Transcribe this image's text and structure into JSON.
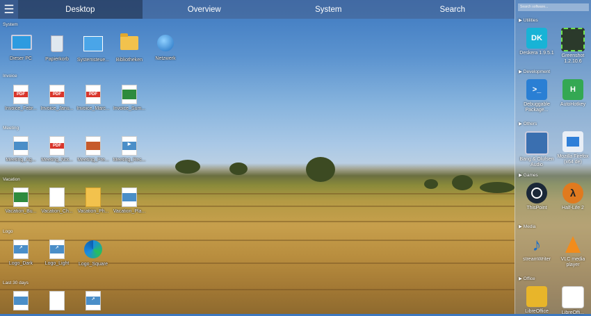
{
  "topbar": {
    "menu_icon": "hamburger-icon",
    "tabs": [
      {
        "label": "Desktop",
        "active": true
      },
      {
        "label": "Overview",
        "active": false
      },
      {
        "label": "System",
        "active": false
      },
      {
        "label": "Search",
        "active": false
      }
    ]
  },
  "sections": {
    "system": {
      "label": "System",
      "items": [
        "Dieser PC",
        "Papierkorb",
        "Systemsteue...",
        "Bibliotheken",
        "Netzwerk"
      ]
    },
    "invoice": {
      "label": "Invoice",
      "items": [
        "Invoice_Febr...",
        "Invoice_Janu...",
        "Invoice_Marc...",
        "Invoice_Sum..."
      ]
    },
    "meeting": {
      "label": "Meeting",
      "items": [
        "Meeting_Ag...",
        "Meeting_Not...",
        "Meeting_Pre...",
        "Meeting_Rec..."
      ]
    },
    "vacation": {
      "label": "Vacation",
      "items": [
        "Vacation_Bu...",
        "Vacation_Ch...",
        "Vacation_Ph...",
        "Vacation_Pla..."
      ]
    },
    "logo": {
      "label": "Logo",
      "items": [
        "Logo_Dark",
        "Logo_Light",
        "Logo_Square"
      ]
    },
    "last30": {
      "label": "Last 30 days",
      "items": [
        "",
        "",
        ""
      ]
    }
  },
  "panel": {
    "search_placeholder": "Search software...",
    "categories": {
      "utilities": "▶ Utilities",
      "development": "▶ Development",
      "others": "▶ Others",
      "games": "▶ Games",
      "media": "▶ Media",
      "office": "▶ Office"
    },
    "apps": {
      "deskera": {
        "name": "Deskera 1.9.5.1",
        "tile_text": "DK",
        "color": "#18b3d6"
      },
      "greenshot": {
        "name": "Greenshot 1.2.10.6",
        "tile_text": "",
        "color": "#2b3a2b"
      },
      "debuggable": {
        "name": "Debuggable Package...",
        "tile_text": ">_",
        "color": "#2a7fd4"
      },
      "autohotkey": {
        "name": "AutoHotkey",
        "tile_text": "H",
        "color": "#34a853"
      },
      "bang": {
        "name": "Bang & Olufsen Audio",
        "tile_text": "",
        "color": "#3a6fb0"
      },
      "firefox": {
        "name": "Mozilla Firefox (x64 de)",
        "tile_text": "",
        "color": "#2f7fd8"
      },
      "thispoint": {
        "name": "ThisPoint",
        "tile_text": "",
        "color": "#1b2838"
      },
      "halflife": {
        "name": "Half-Life 2",
        "tile_text": "λ",
        "color": "#e07a1f"
      },
      "streamwriter": {
        "name": "streamWriter",
        "tile_text": "♪",
        "color": "#1f6fc8"
      },
      "vlc": {
        "name": "VLC media player",
        "tile_text": "",
        "color": "#f28c1c"
      },
      "libreoffice": {
        "name": "LibreOffice",
        "tile_text": "",
        "color": "#e8b52a"
      },
      "office2": {
        "name": "LibreOffi...",
        "tile_text": "",
        "color": "#ffffff"
      }
    }
  }
}
